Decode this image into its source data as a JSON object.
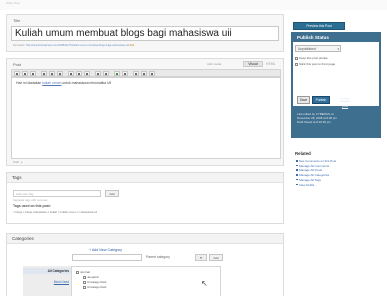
{
  "header": {
    "crumb": "Write Post"
  },
  "title_box": {
    "label": "Title",
    "value": "Kuliah umum membuat blogs bagi mahasiswa uii",
    "permalink_label": "Permalink:",
    "permalink_url": "http://simplewordpress.com/2008/11/27/kuliah-umum-membuat-blogs-bagi-mahasiswa-uii/",
    "permalink_edit": "Edit"
  },
  "post_box": {
    "label": "Post",
    "upload_label": "Add media",
    "tab_visual": "Visual",
    "tab_html": "HTML",
    "content_prefix": "Hari ini diadakan ",
    "content_link": "kuliah umum",
    "content_suffix": " untuk mahasiswa informatika UII",
    "path_label": "Path: p"
  },
  "tags_box": {
    "label": "Tags",
    "input_placeholder": "Add new Tag",
    "add_button": "Add",
    "hint": "Separate tags with commas",
    "used_title": "Tags used on this post:",
    "used_tags": "× blogs  × blogs mahasiswa  × kuliah  × kuliah umum  × mahasiswa uii"
  },
  "categories_box": {
    "label": "Categories",
    "add_new_link": "+ Add New Category",
    "parent_label": "Parent category",
    "parent_dropdown": "▾",
    "add_button": "Add",
    "tab_all": "All Categories",
    "tab_used": "Most Used",
    "items": [
      "Journal",
      "Jeopardi",
      "Uncategorized",
      "Uncategorized"
    ]
  },
  "sidebar": {
    "preview_button": "Preview this Post",
    "publish_title": "Publish Status",
    "status_value": "Unpublished",
    "keep_pending": "Keep this post private",
    "stick_front": "Stick this post to front page",
    "save_button": "Save",
    "publish_button": "Publish",
    "delete_link": "Delete post",
    "meta_line1": "Last edited by CYBERGS on",
    "meta_line2": "November 28, 2008 at 8:09 pm",
    "meta_line3": "Draft Saved at 8:23:30 pm",
    "related_title": "Related",
    "related_links": [
      "See Comments on this Post",
      "Manage All Comments",
      "Manage All Posts",
      "Manage All Categories",
      "Manage All Tags",
      "View Drafts"
    ]
  },
  "colors": {
    "publish_panel": "#3f6f8e",
    "preview_button": "#2b6e93",
    "link": "#3a6cb0"
  }
}
